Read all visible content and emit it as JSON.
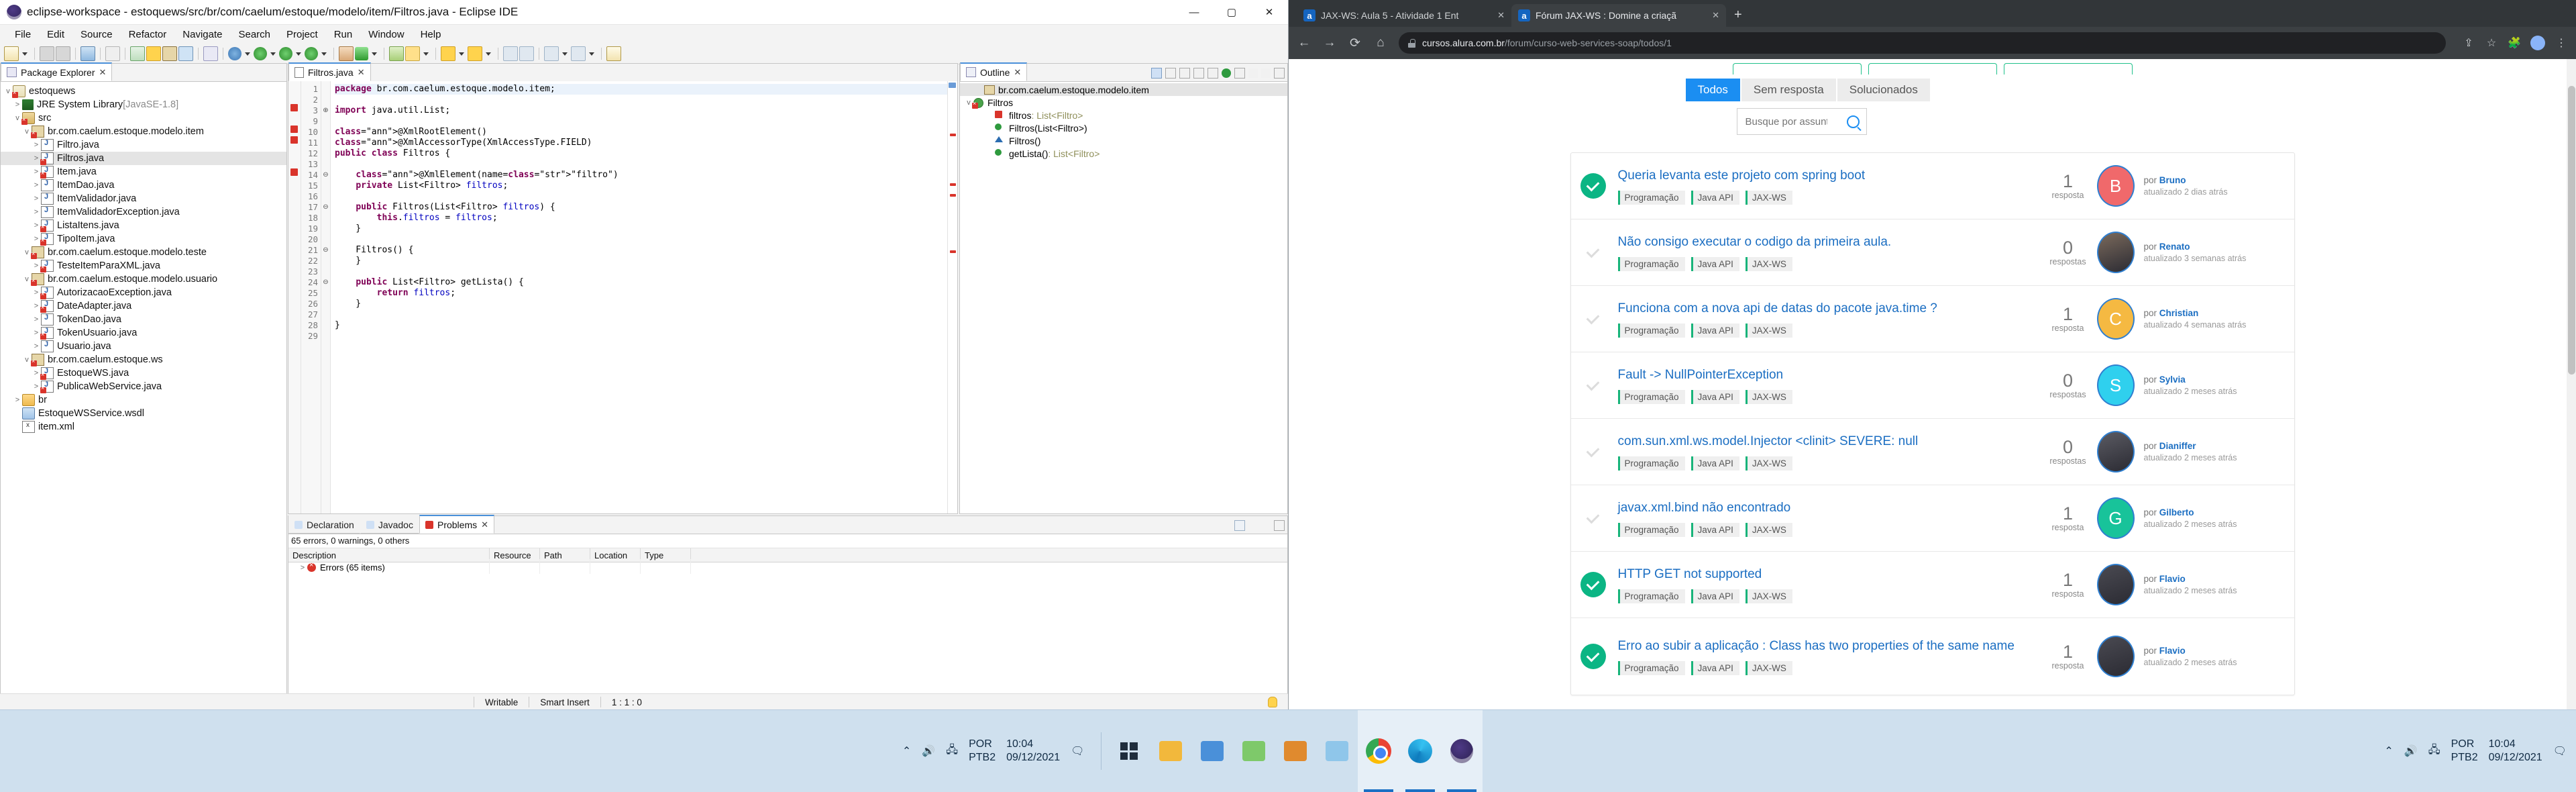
{
  "eclipse": {
    "title": "eclipse-workspace - estoquews/src/br/com/caelum/estoque/modelo/item/Filtros.java - Eclipse IDE",
    "menu": [
      "File",
      "Edit",
      "Source",
      "Refactor",
      "Navigate",
      "Search",
      "Project",
      "Run",
      "Window",
      "Help"
    ],
    "window_buttons": {
      "minimize": "—",
      "maximize": "▢",
      "close": "✕"
    },
    "package_explorer": {
      "tab_label": "Package Explorer",
      "tab_close": "✕",
      "tree": [
        {
          "label": "estoquews",
          "indent": 0,
          "arrow": "v",
          "icon": "project-icon",
          "error": true
        },
        {
          "label": "JRE System Library",
          "suffix": "[JavaSE-1.8]",
          "indent": 1,
          "arrow": ">",
          "icon": "jre-library-icon",
          "error": false
        },
        {
          "label": "src",
          "indent": 1,
          "arrow": "v",
          "icon": "source-folder-icon",
          "error": true
        },
        {
          "label": "br.com.caelum.estoque.modelo.item",
          "indent": 2,
          "arrow": "v",
          "icon": "package-icon",
          "error": true
        },
        {
          "label": "Filtro.java",
          "indent": 3,
          "arrow": ">",
          "icon": "java-file-icon",
          "error": false
        },
        {
          "label": "Filtros.java",
          "indent": 3,
          "arrow": ">",
          "icon": "java-file-icon",
          "error": true,
          "selected": true
        },
        {
          "label": "Item.java",
          "indent": 3,
          "arrow": ">",
          "icon": "java-file-icon",
          "error": true
        },
        {
          "label": "ItemDao.java",
          "indent": 3,
          "arrow": ">",
          "icon": "java-file-icon",
          "error": false
        },
        {
          "label": "ItemValidador.java",
          "indent": 3,
          "arrow": ">",
          "icon": "java-file-icon",
          "error": false
        },
        {
          "label": "ItemValidadorException.java",
          "indent": 3,
          "arrow": ">",
          "icon": "java-file-icon",
          "error": false
        },
        {
          "label": "ListaItens.java",
          "indent": 3,
          "arrow": ">",
          "icon": "java-file-icon",
          "error": true
        },
        {
          "label": "TipoItem.java",
          "indent": 3,
          "arrow": ">",
          "icon": "java-enum-icon",
          "error": true
        },
        {
          "label": "br.com.caelum.estoque.modelo.teste",
          "indent": 2,
          "arrow": "v",
          "icon": "package-icon",
          "error": true
        },
        {
          "label": "TesteItemParaXML.java",
          "indent": 3,
          "arrow": ">",
          "icon": "java-file-icon",
          "error": true
        },
        {
          "label": "br.com.caelum.estoque.modelo.usuario",
          "indent": 2,
          "arrow": "v",
          "icon": "package-icon",
          "error": true
        },
        {
          "label": "AutorizacaoException.java",
          "indent": 3,
          "arrow": ">",
          "icon": "java-file-icon",
          "error": true
        },
        {
          "label": "DateAdapter.java",
          "indent": 3,
          "arrow": ">",
          "icon": "java-file-icon",
          "error": true
        },
        {
          "label": "TokenDao.java",
          "indent": 3,
          "arrow": ">",
          "icon": "java-file-icon",
          "error": false
        },
        {
          "label": "TokenUsuario.java",
          "indent": 3,
          "arrow": ">",
          "icon": "java-file-icon",
          "error": true
        },
        {
          "label": "Usuario.java",
          "indent": 3,
          "arrow": ">",
          "icon": "java-file-icon",
          "error": false
        },
        {
          "label": "br.com.caelum.estoque.ws",
          "indent": 2,
          "arrow": "v",
          "icon": "package-icon",
          "error": true
        },
        {
          "label": "EstoqueWS.java",
          "indent": 3,
          "arrow": ">",
          "icon": "java-file-icon",
          "error": true
        },
        {
          "label": "PublicaWebService.java",
          "indent": 3,
          "arrow": ">",
          "icon": "java-file-icon",
          "error": true
        },
        {
          "label": "br",
          "indent": 1,
          "arrow": ">",
          "icon": "folder-icon",
          "error": false
        },
        {
          "label": "EstoqueWSService.wsdl",
          "indent": 1,
          "arrow": "",
          "icon": "wsdl-file-icon",
          "error": false
        },
        {
          "label": "item.xml",
          "indent": 1,
          "arrow": "",
          "icon": "xml-file-icon",
          "error": false
        }
      ]
    },
    "editor": {
      "tab_label": "Filtros.java",
      "tab_close": "✕",
      "lines": [
        {
          "n": "1",
          "fold": "",
          "text": "package br.com.caelum.estoque.modelo.item;",
          "current": true
        },
        {
          "n": "2",
          "fold": "",
          "text": ""
        },
        {
          "n": "3",
          "fold": "⊕",
          "text": "import java.util.List;",
          "marker": "error"
        },
        {
          "n": "9",
          "fold": "",
          "text": ""
        },
        {
          "n": "10",
          "fold": "",
          "text": "@XmlRootElement()",
          "marker": "error"
        },
        {
          "n": "11",
          "fold": "",
          "text": "@XmlAccessorType(XmlAccessType.FIELD)",
          "marker": "error"
        },
        {
          "n": "12",
          "fold": "",
          "text": "public class Filtros {"
        },
        {
          "n": "13",
          "fold": "",
          "text": ""
        },
        {
          "n": "14",
          "fold": "⊖",
          "text": "    @XmlElement(name=\"filtro\")",
          "marker": "error"
        },
        {
          "n": "15",
          "fold": "",
          "text": "    private List<Filtro> filtros;"
        },
        {
          "n": "16",
          "fold": "",
          "text": ""
        },
        {
          "n": "17",
          "fold": "⊖",
          "text": "    public Filtros(List<Filtro> filtros) {"
        },
        {
          "n": "18",
          "fold": "",
          "text": "        this.filtros = filtros;"
        },
        {
          "n": "19",
          "fold": "",
          "text": "    }"
        },
        {
          "n": "20",
          "fold": "",
          "text": ""
        },
        {
          "n": "21",
          "fold": "⊖",
          "text": "    Filtros() {"
        },
        {
          "n": "22",
          "fold": "",
          "text": "    }"
        },
        {
          "n": "23",
          "fold": "",
          "text": ""
        },
        {
          "n": "24",
          "fold": "⊖",
          "text": "    public List<Filtro> getLista() {"
        },
        {
          "n": "25",
          "fold": "",
          "text": "        return filtros;"
        },
        {
          "n": "26",
          "fold": "",
          "text": "    }"
        },
        {
          "n": "27",
          "fold": "",
          "text": ""
        },
        {
          "n": "28",
          "fold": "",
          "text": "}"
        },
        {
          "n": "29",
          "fold": "",
          "text": ""
        }
      ]
    },
    "outline": {
      "tab_label": "Outline",
      "tab_close": "✕",
      "items": [
        {
          "label": "br.com.caelum.estoque.modelo.item",
          "type": "",
          "icon": "package-icon",
          "indent": 1,
          "arrow": "",
          "selected": true
        },
        {
          "label": "Filtros",
          "type": "",
          "icon": "class-icon",
          "indent": 0,
          "arrow": "v",
          "error": true
        },
        {
          "label": "filtros",
          "type": " : List<Filtro>",
          "icon": "field-error-icon",
          "indent": 2,
          "arrow": ""
        },
        {
          "label": "Filtros(List<Filtro>)",
          "type": "",
          "icon": "constructor-public-icon",
          "indent": 2,
          "arrow": ""
        },
        {
          "label": "Filtros()",
          "type": "",
          "icon": "constructor-default-icon",
          "indent": 2,
          "arrow": ""
        },
        {
          "label": "getLista()",
          "type": " : List<Filtro>",
          "icon": "method-public-icon",
          "indent": 2,
          "arrow": ""
        }
      ]
    },
    "problems": {
      "tabs": [
        {
          "label": "Problems",
          "active": true,
          "close": "✕",
          "icon": "problems-icon"
        },
        {
          "label": "Javadoc",
          "active": false,
          "icon": "javadoc-icon"
        },
        {
          "label": "Declaration",
          "active": false,
          "icon": "declaration-icon"
        }
      ],
      "summary": "65 errors, 0 warnings, 0 others",
      "columns": [
        "Description",
        "Resource",
        "Path",
        "Location",
        "Type"
      ],
      "rows": [
        {
          "description": "Errors (65 items)",
          "resource": "",
          "path": "",
          "location": "",
          "type": ""
        }
      ]
    },
    "status_bar": {
      "writable": "Writable",
      "insert_mode": "Smart Insert",
      "position": "1 : 1 : 0"
    }
  },
  "browser": {
    "tabs": [
      {
        "title": "JAX-WS: Aula 5 - Atividade 1 Ent",
        "active": false,
        "favicon": "a",
        "close": "✕"
      },
      {
        "title": "Fórum JAX-WS : Domine a criaçã",
        "active": true,
        "favicon": "a",
        "close": "✕"
      }
    ],
    "new_tab": "+",
    "nav": {
      "back": "←",
      "forward": "→",
      "reload": "⟳",
      "home": "⌂"
    },
    "url_domain": "cursos.alura.com.br",
    "url_path": "/forum/curso-web-services-soap/todos/1",
    "toolbar_icons": [
      "share-icon",
      "star-icon",
      "extensions-icon",
      "profile-avatar",
      "menu-icon"
    ]
  },
  "forum": {
    "category_pills": [
      "pill-1",
      "pill-2",
      "pill-3"
    ],
    "filters": [
      {
        "label": "Todos",
        "active": true
      },
      {
        "label": "Sem resposta",
        "active": false
      },
      {
        "label": "Solucionados",
        "active": false
      }
    ],
    "search": {
      "placeholder": "Busque por assunto",
      "value": "",
      "icon": "search-icon"
    },
    "topics": [
      {
        "title": "Queria levanta este projeto com spring boot",
        "solved": true,
        "tags": [
          "Programação",
          "Java API",
          "JAX-WS"
        ],
        "reply_count": "1",
        "reply_label": "resposta",
        "author": "Bruno",
        "by_label": "por",
        "updated": "atualizado 2 dias atrás",
        "avatar_type": "initial",
        "avatar_initial": "B",
        "avatar_color": "#f0696b",
        "tall": false
      },
      {
        "title": "Não consigo executar o codigo da primeira aula.",
        "solved": false,
        "tags": [
          "Programação",
          "Java API",
          "JAX-WS"
        ],
        "reply_count": "0",
        "reply_label": "respostas",
        "author": "Renato",
        "by_label": "por",
        "updated": "atualizado 3 semanas atrás",
        "avatar_type": "photo",
        "avatar_initial": "",
        "avatar_color": "#7b6a5c",
        "tall": false
      },
      {
        "title": "Funciona com a nova api de datas do pacote java.time ?",
        "solved": false,
        "tags": [
          "Programação",
          "Java API",
          "JAX-WS"
        ],
        "reply_count": "1",
        "reply_label": "resposta",
        "author": "Christian",
        "by_label": "por",
        "updated": "atualizado 4 semanas atrás",
        "avatar_type": "initial",
        "avatar_initial": "C",
        "avatar_color": "#f5b942",
        "tall": false
      },
      {
        "title": "Fault -> NullPointerException",
        "solved": false,
        "tags": [
          "Programação",
          "Java API",
          "JAX-WS"
        ],
        "reply_count": "0",
        "reply_label": "respostas",
        "author": "Sylvia",
        "by_label": "por",
        "updated": "atualizado 2 meses atrás",
        "avatar_type": "initial",
        "avatar_initial": "S",
        "avatar_color": "#2fd0ee",
        "tall": false
      },
      {
        "title": "com.sun.xml.ws.model.Injector <clinit> SEVERE: null",
        "solved": false,
        "tags": [
          "Programação",
          "Java API",
          "JAX-WS"
        ],
        "reply_count": "0",
        "reply_label": "respostas",
        "author": "Dianiffer",
        "by_label": "por",
        "updated": "atualizado 2 meses atrás",
        "avatar_type": "photo",
        "avatar_initial": "",
        "avatar_color": "#5b5b63",
        "tall": false
      },
      {
        "title": "javax.xml.bind não encontrado",
        "solved": false,
        "tags": [
          "Programação",
          "Java API",
          "JAX-WS"
        ],
        "reply_count": "1",
        "reply_label": "resposta",
        "author": "Gilberto",
        "by_label": "por",
        "updated": "atualizado 2 meses atrás",
        "avatar_type": "initial",
        "avatar_initial": "G",
        "avatar_color": "#18c39a",
        "tall": false
      },
      {
        "title": "HTTP GET not supported",
        "solved": true,
        "tags": [
          "Programação",
          "Java API",
          "JAX-WS"
        ],
        "reply_count": "1",
        "reply_label": "resposta",
        "author": "Flavio",
        "by_label": "por",
        "updated": "atualizado 2 meses atrás",
        "avatar_type": "photo",
        "avatar_initial": "",
        "avatar_color": "#4a4a52",
        "tall": false
      },
      {
        "title": "Erro ao subir a aplicação : Class has two properties of the same name",
        "solved": true,
        "tags": [
          "Programação",
          "Java API",
          "JAX-WS"
        ],
        "reply_count": "1",
        "reply_label": "resposta",
        "author": "Flavio",
        "by_label": "por",
        "updated": "atualizado 2 meses atrás",
        "avatar_type": "photo",
        "avatar_initial": "",
        "avatar_color": "#4a4a52",
        "tall": true
      }
    ]
  },
  "taskbar": {
    "left_tray": {
      "chevron": "⌃",
      "volume_icon": "volume-icon",
      "network_icon": "network-icon",
      "lang_line1": "POR",
      "lang_line2": "PTB2",
      "time": "10:04",
      "date": "09/12/2021",
      "notification_icon": "notification-icon"
    },
    "apps": [
      {
        "name": "start-button",
        "glyph": "⊞"
      },
      {
        "name": "file-explorer",
        "glyph": "📁"
      },
      {
        "name": "contacts-app",
        "glyph": "🗂"
      },
      {
        "name": "notepad-app",
        "glyph": "📝"
      },
      {
        "name": "media-player",
        "glyph": "▶"
      },
      {
        "name": "reader-app",
        "glyph": "📘"
      },
      {
        "name": "chrome-browser",
        "glyph": "◎",
        "active": true
      },
      {
        "name": "edge-browser",
        "glyph": "◉",
        "active": true
      },
      {
        "name": "eclipse-ide",
        "glyph": "◍",
        "active": true
      }
    ],
    "right_tray": {
      "chevron": "⌃",
      "lang_line1": "POR",
      "lang_line2": "PTB2",
      "time": "10:04",
      "date": "09/12/2021"
    }
  }
}
